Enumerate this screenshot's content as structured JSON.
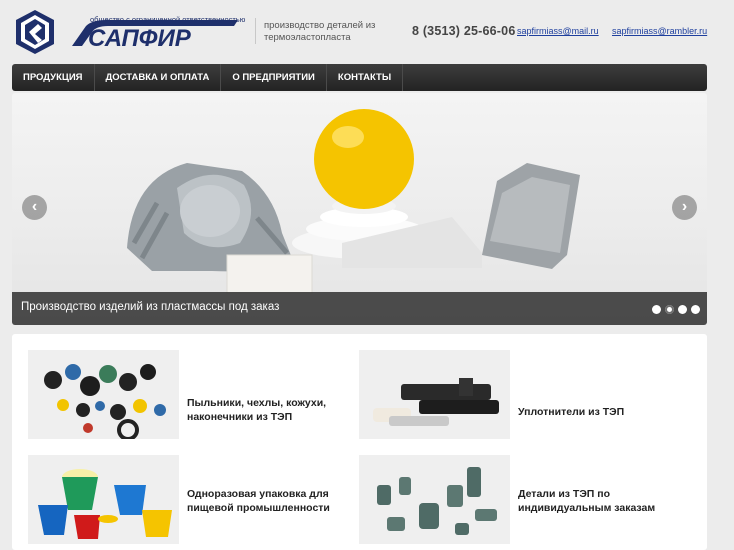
{
  "header": {
    "company_caption": "общество с ограниченной ответственностью",
    "tagline": "производство деталей из термоэластопласта",
    "phone": "8 (3513) 25-66-06",
    "emails": [
      "sapfirmiass@mail.ru",
      "sapfirmiass@rambler.ru"
    ]
  },
  "nav": {
    "items": [
      "ПРОДУКЦИЯ",
      "ДОСТАВКА И ОПЛАТА",
      "О ПРЕДПРИЯТИИ",
      "КОНТАКТЫ"
    ]
  },
  "slider": {
    "caption": "Производство изделий из пластмассы под заказ",
    "prev_icon": "chevron-left-icon",
    "next_icon": "chevron-right-icon",
    "slide_count": 4,
    "active_slide": 2
  },
  "products": [
    {
      "title": "Пыльники, чехлы, кожухи, наконечники из ТЭП"
    },
    {
      "title": "Уплотнители из ТЭП"
    },
    {
      "title": "Одноразовая упаковка для пищевой промышленности"
    },
    {
      "title": "Детали из ТЭП по индивидуальным заказам"
    }
  ],
  "colors": {
    "brand_blue": "#1e2f6b",
    "nav_bg": "#2e2e2e",
    "link": "#1e3f9e",
    "accent_yellow": "#f5c400"
  }
}
